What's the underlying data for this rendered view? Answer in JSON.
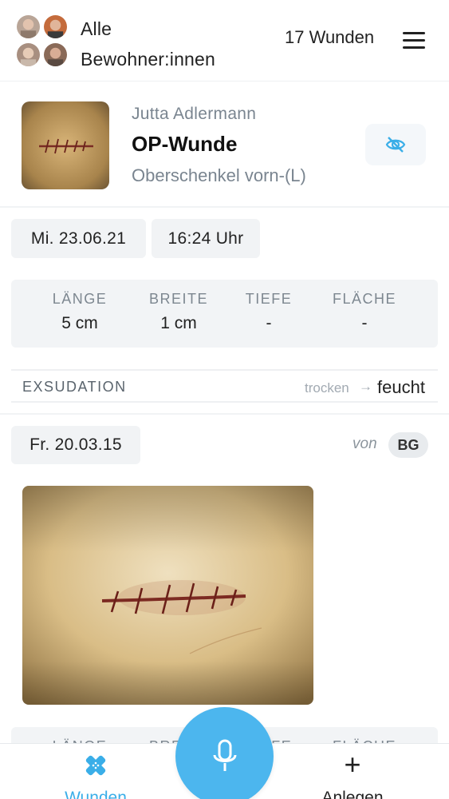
{
  "header": {
    "resident_line1": "Alle",
    "resident_line2": "Bewohner:innen",
    "wound_count": "17 Wunden",
    "menu_icon": "hamburger-menu-icon"
  },
  "wound": {
    "patient_name": "Jutta Adlermann",
    "type": "OP-Wunde",
    "location": "Oberschenkel vorn-(L)",
    "visibility_icon": "eye-off-icon",
    "accent_color": "#3aaee8"
  },
  "entry1": {
    "date": "Mi. 23.06.21",
    "time": "16:24 Uhr",
    "measurements": [
      {
        "label": "LÄNGE",
        "value": "5 cm"
      },
      {
        "label": "BREITE",
        "value": "1 cm"
      },
      {
        "label": "TIEFE",
        "value": "-"
      },
      {
        "label": "FLÄCHE",
        "value": "-"
      }
    ],
    "exsudation": {
      "label": "EXSUDATION",
      "from": "trocken",
      "arrow": "→",
      "to": "feucht"
    }
  },
  "entry2": {
    "date": "Fr. 20.03.15",
    "by_label": "von",
    "initials": "BG",
    "measurements": [
      {
        "label": "LÄNGE"
      },
      {
        "label": "BREITE"
      },
      {
        "label": "TIEFE"
      },
      {
        "label": "FLÄCHE"
      }
    ]
  },
  "nav": {
    "wounds_label": "Wunden",
    "wounds_icon": "bandage-icon",
    "mic_icon": "microphone-icon",
    "create_label": "Anlegen",
    "create_icon": "plus-icon"
  }
}
